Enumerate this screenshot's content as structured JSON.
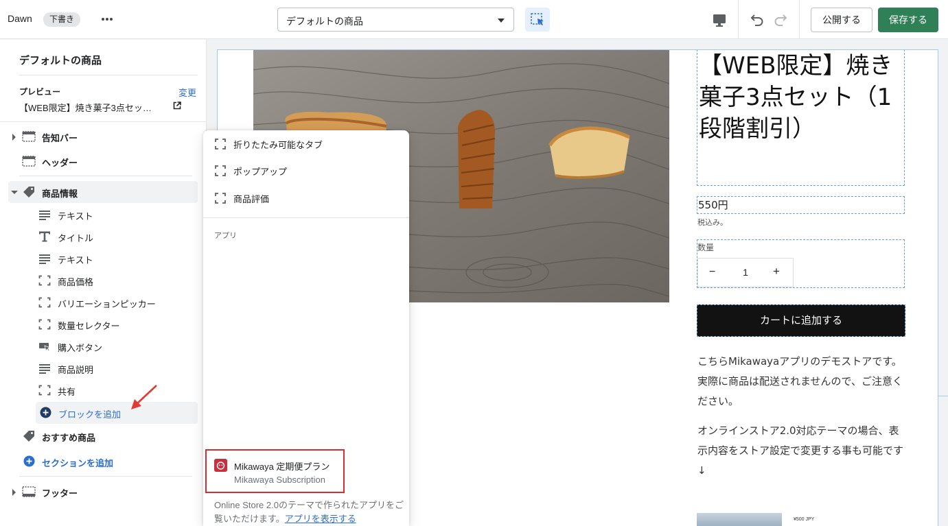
{
  "topbar": {
    "theme_name": "Dawn",
    "draft_badge": "下書き",
    "more_label": "•••",
    "page_select": "デフォルトの商品",
    "publish_label": "公開する",
    "save_label": "保存する",
    "accent_color": "#2f7f57"
  },
  "sidebar": {
    "title": "デフォルトの商品",
    "preview_label": "プレビュー",
    "change_label": "変更",
    "preview_value": "【WEB限定】焼き菓子3点セッ…",
    "sections_top": [
      {
        "label": "告知バー",
        "icon": "layout-icon"
      },
      {
        "label": "ヘッダー",
        "icon": "header-layout-icon"
      }
    ],
    "product_section": {
      "label": "商品情報",
      "icon": "tag-icon"
    },
    "blocks": [
      {
        "label": "テキスト",
        "icon": "text-lines-icon"
      },
      {
        "label": "タイトル",
        "icon": "title-t-icon"
      },
      {
        "label": "テキスト",
        "icon": "text-lines-icon"
      },
      {
        "label": "商品価格",
        "icon": "dashed-box-icon"
      },
      {
        "label": "バリエーションピッカー",
        "icon": "dashed-box-icon"
      },
      {
        "label": "数量セレクター",
        "icon": "dashed-box-icon"
      },
      {
        "label": "購入ボタン",
        "icon": "buy-button-icon"
      },
      {
        "label": "商品説明",
        "icon": "text-lines-icon"
      },
      {
        "label": "共有",
        "icon": "dashed-box-icon"
      }
    ],
    "add_block": "ブロックを追加",
    "recommend_section": "おすすめ商品",
    "add_section": "セクションを追加",
    "footer_section": "フッター"
  },
  "popover": {
    "items": [
      {
        "label": "折りたたみ可能なタブ",
        "icon": "dashed-box-icon"
      },
      {
        "label": "ポップアップ",
        "icon": "dashed-box-icon"
      },
      {
        "label": "商品評価",
        "icon": "dashed-box-icon"
      }
    ],
    "section_label": "アプリ",
    "app_name": "Mikawaya 定期便プラン",
    "app_subtitle": "Mikawaya Subscription",
    "footer_text": "Online Store 2.0のテーマで作られたアプリをご覧いただけます。",
    "footer_link": "アプリを表示する"
  },
  "product": {
    "title": "【WEB限定】焼き菓子3点セット（1段階割引）",
    "price": "550円",
    "tax_note": "税込み。",
    "quantity_label": "数量",
    "quantity_minus": "−",
    "quantity_value": "1",
    "quantity_plus": "+",
    "add_to_cart": "カートに追加する",
    "desc_paragraph_1": "こちらMikawayaアプリのデモストアです。実際に商品は配送されませんので、ご注意ください。",
    "desc_paragraph_2": "オンラインストア2.0対応テーマの場合、表示内容をストア設定で変更する事も可能です↓",
    "small_price": "¥500 JPY"
  }
}
